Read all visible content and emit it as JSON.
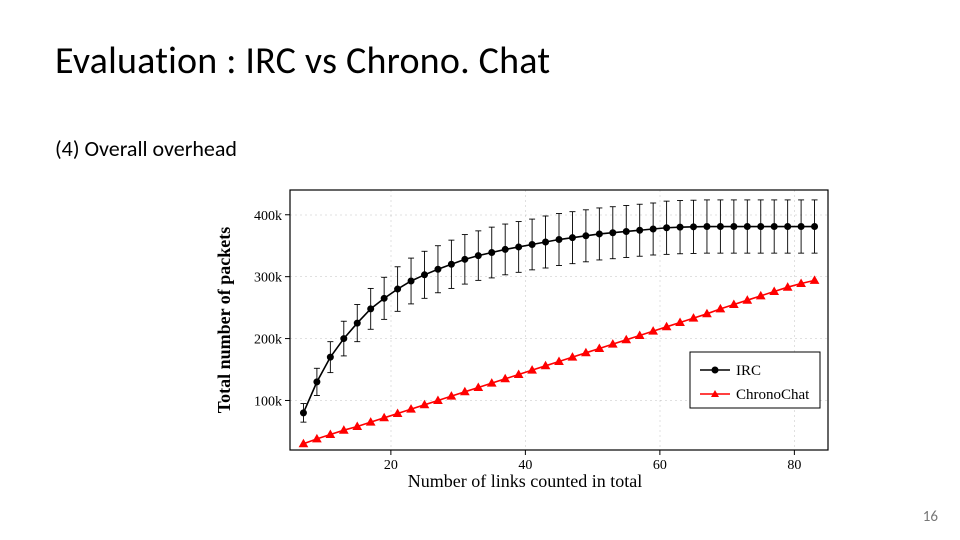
{
  "title": "Evaluation : IRC vs Chrono. Chat",
  "subtitle": "(4) Overall overhead",
  "page_number": "16",
  "chart_data": {
    "type": "line",
    "xlabel": "Number of links counted in total",
    "ylabel": "Total number of packets",
    "xlim": [
      5,
      85
    ],
    "ylim": [
      20000,
      440000
    ],
    "x_ticks": [
      20,
      40,
      60,
      80
    ],
    "y_ticks": [
      100000,
      200000,
      300000,
      400000
    ],
    "y_tick_labels": [
      "100k",
      "200k",
      "300k",
      "400k"
    ],
    "series": [
      {
        "name": "IRC",
        "color": "#000000",
        "marker": "circle",
        "x": [
          7,
          9,
          11,
          13,
          15,
          17,
          19,
          21,
          23,
          25,
          27,
          29,
          31,
          33,
          35,
          37,
          39,
          41,
          43,
          45,
          47,
          49,
          51,
          53,
          55,
          57,
          59,
          61,
          63,
          65,
          67,
          69,
          71,
          73,
          75,
          77,
          79,
          81,
          83
        ],
        "y": [
          80000,
          130000,
          170000,
          200000,
          225000,
          248000,
          265000,
          280000,
          293000,
          303000,
          312000,
          320000,
          328000,
          334000,
          339000,
          344000,
          348000,
          352000,
          356000,
          360000,
          363000,
          366000,
          369000,
          371000,
          373000,
          375000,
          377000,
          379000,
          380000,
          380500,
          381000,
          381000,
          381000,
          381000,
          381000,
          381000,
          381000,
          381000,
          381000
        ],
        "err": [
          15000,
          22000,
          25000,
          28000,
          30000,
          33000,
          34000,
          36000,
          37000,
          38000,
          38000,
          39000,
          40000,
          40000,
          41000,
          41000,
          41000,
          41000,
          42000,
          42000,
          42000,
          42000,
          42000,
          42000,
          42000,
          42000,
          42000,
          43000,
          43000,
          43000,
          43000,
          43000,
          43000,
          43000,
          43000,
          43000,
          43000,
          43000,
          43000
        ]
      },
      {
        "name": "ChronoChat",
        "color": "#ff0000",
        "marker": "triangle",
        "x": [
          7,
          9,
          11,
          13,
          15,
          17,
          19,
          21,
          23,
          25,
          27,
          29,
          31,
          33,
          35,
          37,
          39,
          41,
          43,
          45,
          47,
          49,
          51,
          53,
          55,
          57,
          59,
          61,
          63,
          65,
          67,
          69,
          71,
          73,
          75,
          77,
          79,
          81,
          83
        ],
        "y": [
          30000,
          38000,
          45000,
          52000,
          58000,
          65000,
          72000,
          79000,
          86000,
          93000,
          100000,
          107000,
          114000,
          121000,
          128000,
          135000,
          142000,
          149000,
          156000,
          163000,
          170000,
          177000,
          184000,
          191000,
          198000,
          205000,
          212000,
          219000,
          226000,
          233000,
          240000,
          248000,
          255000,
          262000,
          269000,
          276000,
          283000,
          289000,
          294000
        ]
      }
    ],
    "legend": {
      "entries": [
        "IRC",
        "ChronoChat"
      ],
      "position": "right"
    }
  }
}
